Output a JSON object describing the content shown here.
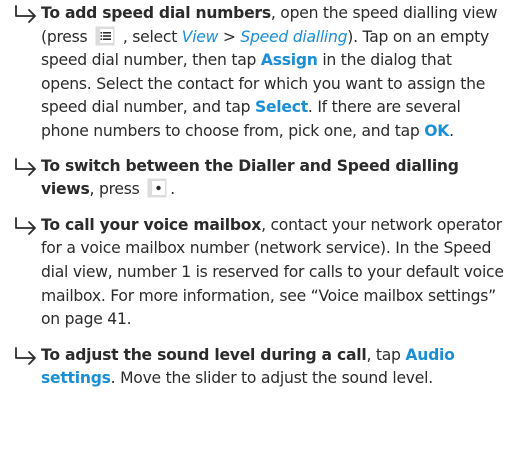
{
  "items": [
    {
      "icon": "hook-arrow-right-icon",
      "lead": "To add speed dial numbers",
      "t1": ", open the speed dialling view (press ",
      "key_icon": "menu-key-icon",
      "t2": " , select ",
      "view": "View",
      "sep": " > ",
      "speed": "Speed dialling",
      "t3": "). Tap on an empty speed dial number, then tap ",
      "assign": "Assign",
      "t4": " in the dialog that opens. Select the contact for which you want to assign the speed dial number, and tap ",
      "select": "Select",
      "t5": ". If there are several phone numbers to choose from, pick one, and tap ",
      "ok": "OK",
      "t6": "."
    },
    {
      "icon": "hook-arrow-right-icon",
      "lead": "To switch between the Dialler and Speed dialling views",
      "t1": ", press ",
      "key_icon": "swap-view-key-icon",
      "t2": "."
    },
    {
      "icon": "hook-arrow-right-icon",
      "lead": "To call your voice mailbox",
      "t1": ", contact your network operator for a voice mailbox number (network service). In the Speed dial view, number 1 is reserved for calls to your default voice mailbox. For more information, see “Voice mailbox settings” on page 41."
    },
    {
      "icon": "hook-arrow-right-icon",
      "lead": "To adjust the sound level during a call",
      "t1": ", tap ",
      "audio": "Audio settings",
      "t2": ". Move the slider to adjust the sound level."
    }
  ],
  "colors": {
    "text": "#2b2b2b",
    "accent": "#1a8fd6"
  }
}
